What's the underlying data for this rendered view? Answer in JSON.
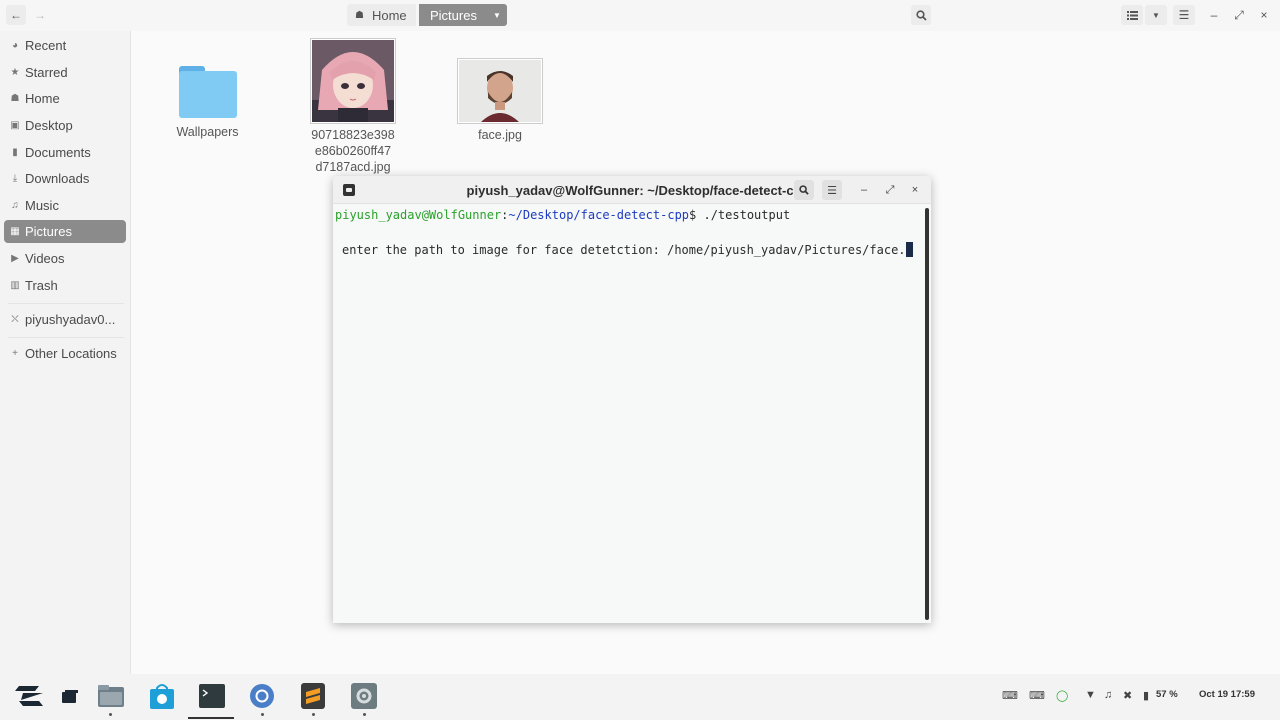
{
  "files": {
    "breadcrumb": {
      "home_label": "Home",
      "current_label": "Pictures"
    },
    "sidebar": {
      "items": [
        {
          "label": "Recent",
          "icon": "clock-icon"
        },
        {
          "label": "Starred",
          "icon": "star-icon"
        },
        {
          "label": "Home",
          "icon": "home-icon"
        },
        {
          "label": "Desktop",
          "icon": "desktop-icon"
        },
        {
          "label": "Documents",
          "icon": "document-icon"
        },
        {
          "label": "Downloads",
          "icon": "download-icon"
        },
        {
          "label": "Music",
          "icon": "music-icon"
        },
        {
          "label": "Pictures",
          "icon": "picture-icon",
          "active": true
        },
        {
          "label": "Videos",
          "icon": "video-icon"
        },
        {
          "label": "Trash",
          "icon": "trash-icon"
        },
        {
          "label": "piyushyadav0...",
          "icon": "drive-icon"
        },
        {
          "label": "Other Locations",
          "icon": "plus-icon"
        }
      ]
    },
    "grid": [
      {
        "line1": "Wallpapers",
        "line2": "",
        "line3": ""
      },
      {
        "line1": "90718823e398",
        "line2": "e86b0260ff47",
        "line3": "d7187acd.jpg"
      },
      {
        "line1": "face.jpg",
        "line2": "",
        "line3": ""
      }
    ]
  },
  "terminal": {
    "title": "piyush_yadav@WolfGunner: ~/Desktop/face-detect-cpp",
    "prompt_user": "piyush_yadav@WolfGunner",
    "prompt_path": "~/Desktop/face-detect-cpp",
    "prompt_suffix": "$ ",
    "command": "./testoutput",
    "output": "enter the path to image for face detetction: /home/piyush_yadav/Pictures/face."
  },
  "tray": {
    "battery": "57 %",
    "datetime": "Oct 19  17:59"
  },
  "colors": {
    "accent": "#8b8b8b",
    "prompt_user": "#2aa12a",
    "prompt_path": "#1d3bbf"
  }
}
